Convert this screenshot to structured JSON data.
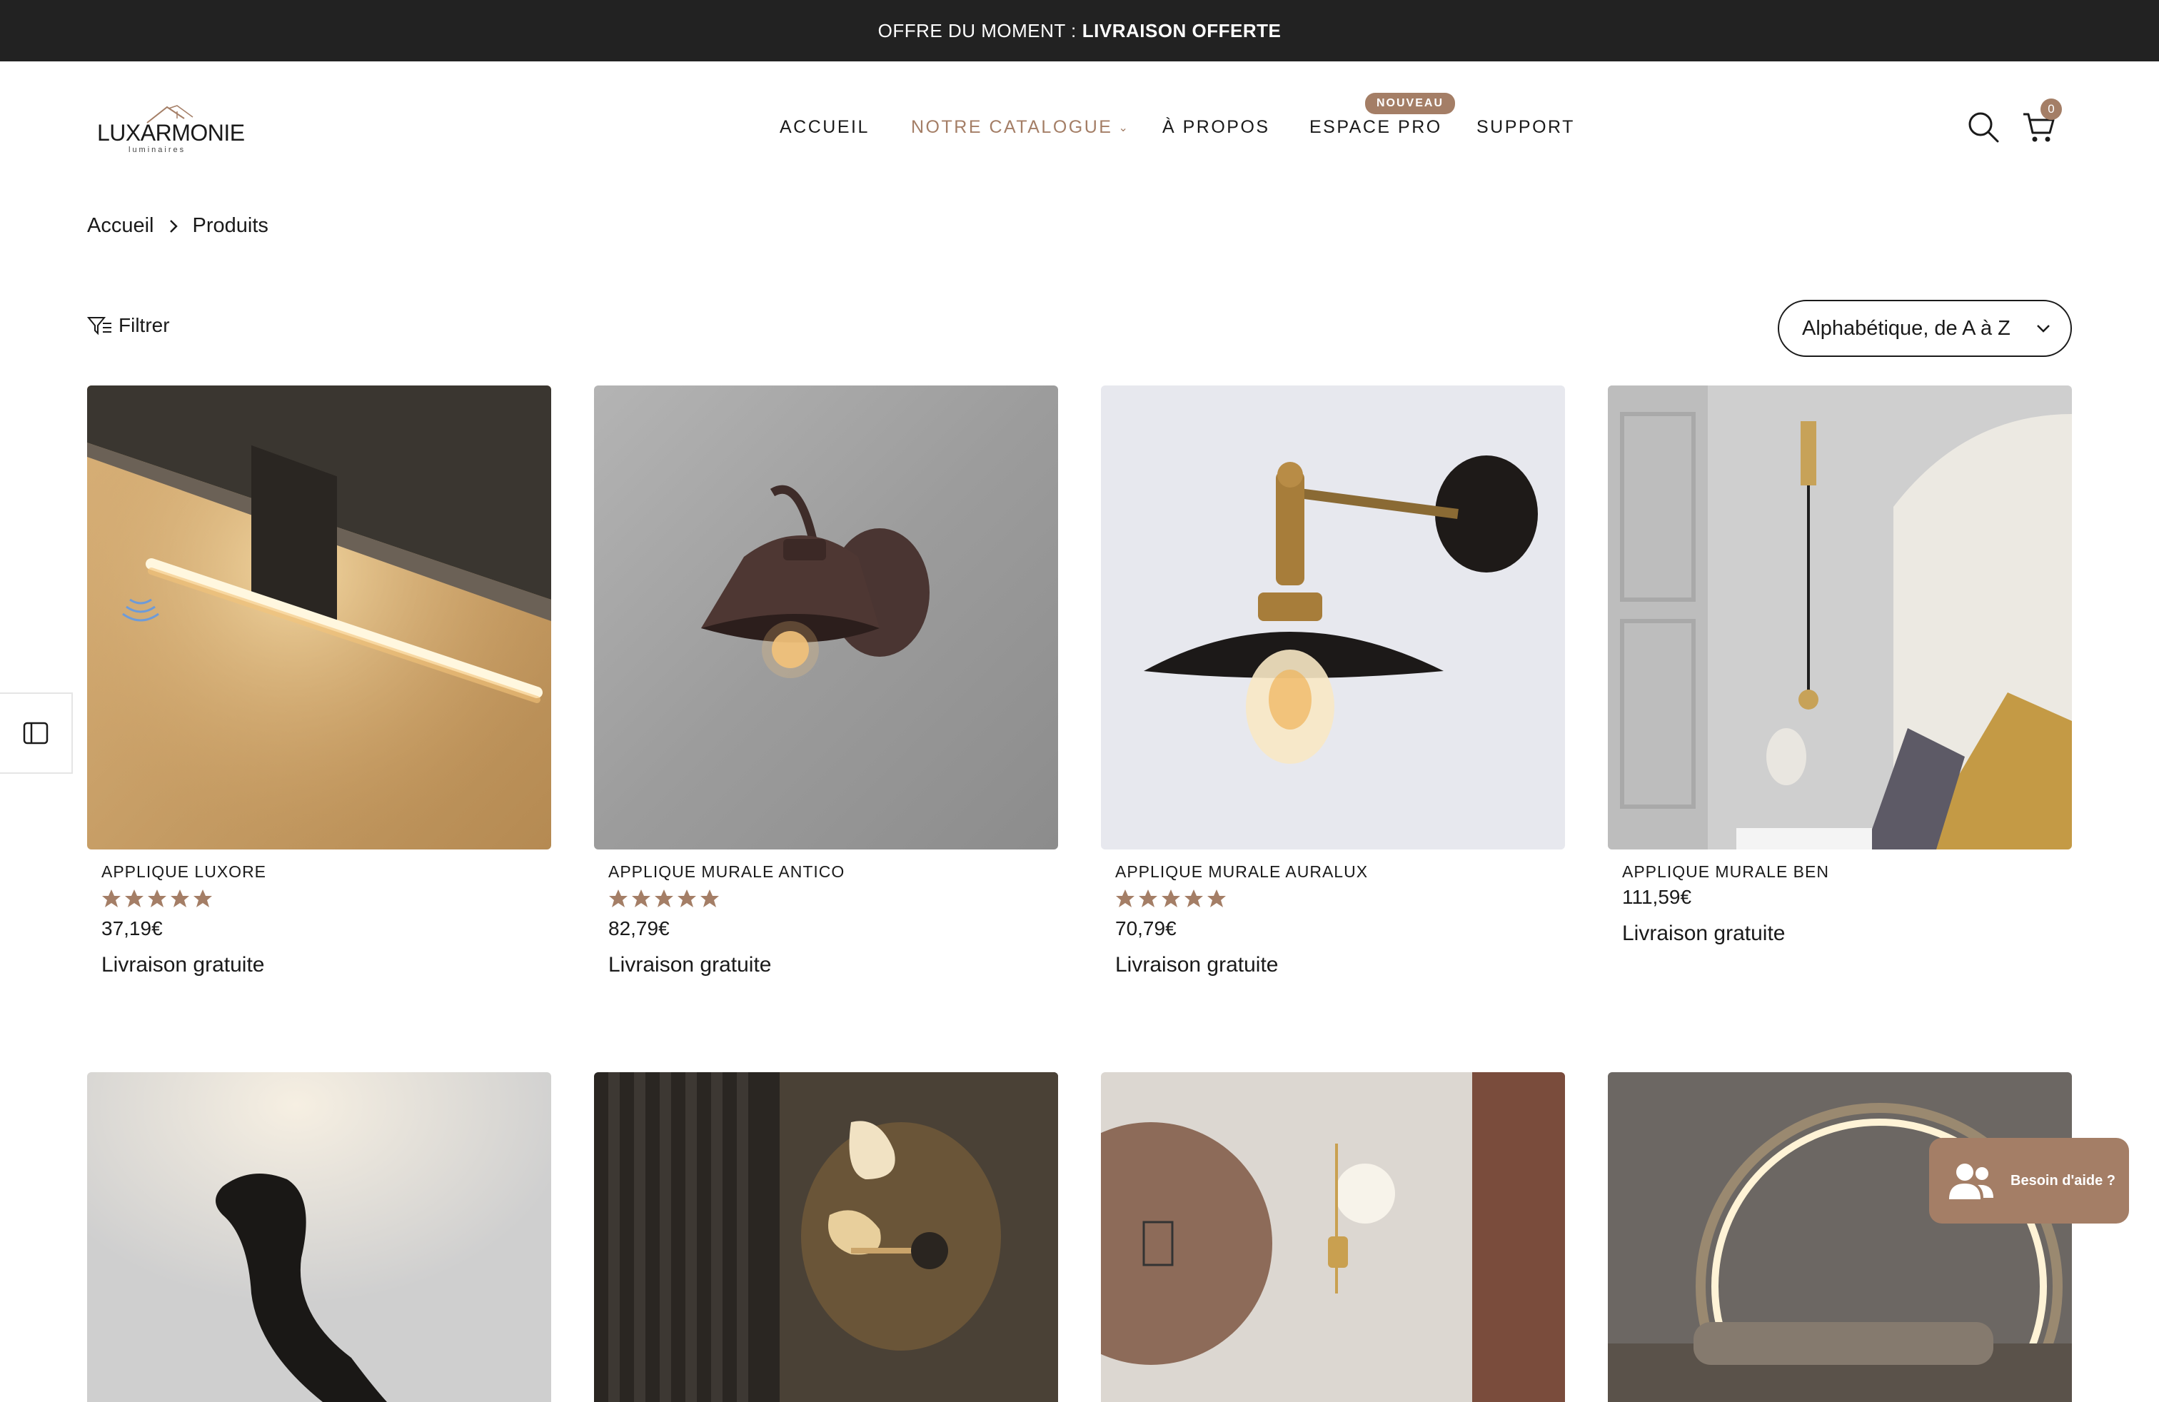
{
  "announcement": {
    "prefix": "OFFRE DU MOMENT : ",
    "highlight": "LIVRAISON OFFERTE"
  },
  "brand": {
    "name": "LUXARMONIE",
    "tagline": "luminaires",
    "accent": "#a47e66"
  },
  "nav": {
    "items": [
      {
        "label": "ACCUEIL"
      },
      {
        "label": "NOTRE CATALOGUE"
      },
      {
        "label": "À PROPOS"
      },
      {
        "label": "ESPACE PRO",
        "badge": "NOUVEAU"
      },
      {
        "label": "SUPPORT"
      }
    ],
    "active": "NOTRE CATALOGUE"
  },
  "cart": {
    "count": "0"
  },
  "breadcrumb": {
    "home": "Accueil",
    "current": "Produits"
  },
  "toolbar": {
    "filter_label": "Filtrer",
    "sort_value": "Alphabétique, de A à Z"
  },
  "products": [
    {
      "title": "APPLIQUE LUXORE",
      "rating": 5,
      "price": "37,19€",
      "shipping": "Livraison gratuite"
    },
    {
      "title": "APPLIQUE MURALE ANTICO",
      "rating": 5,
      "price": "82,79€",
      "shipping": "Livraison gratuite"
    },
    {
      "title": "APPLIQUE MURALE AURALUX",
      "rating": 5,
      "price": "70,79€",
      "shipping": "Livraison gratuite"
    },
    {
      "title": "APPLIQUE MURALE BEN",
      "rating": 0,
      "price": "111,59€",
      "shipping": "Livraison gratuite"
    }
  ],
  "help": {
    "label": "Besoin d'aide ?"
  }
}
